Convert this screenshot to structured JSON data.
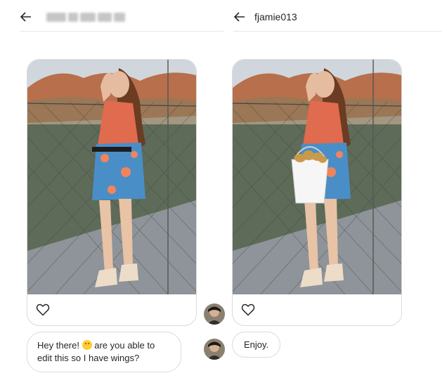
{
  "left": {
    "header": {
      "back_icon": "arrow-left-icon"
    },
    "post": {
      "heart_icon": "heart-outline-icon"
    },
    "message": {
      "text_part1": "Hey there!",
      "emoji": "smiling-face-emoji",
      "text_part2": " are you able to edit this so I have wings?"
    }
  },
  "right": {
    "header": {
      "back_icon": "arrow-left-icon",
      "username": "fjamie013"
    },
    "post": {
      "heart_icon": "heart-outline-icon"
    },
    "message": {
      "text": "Enjoy."
    }
  }
}
